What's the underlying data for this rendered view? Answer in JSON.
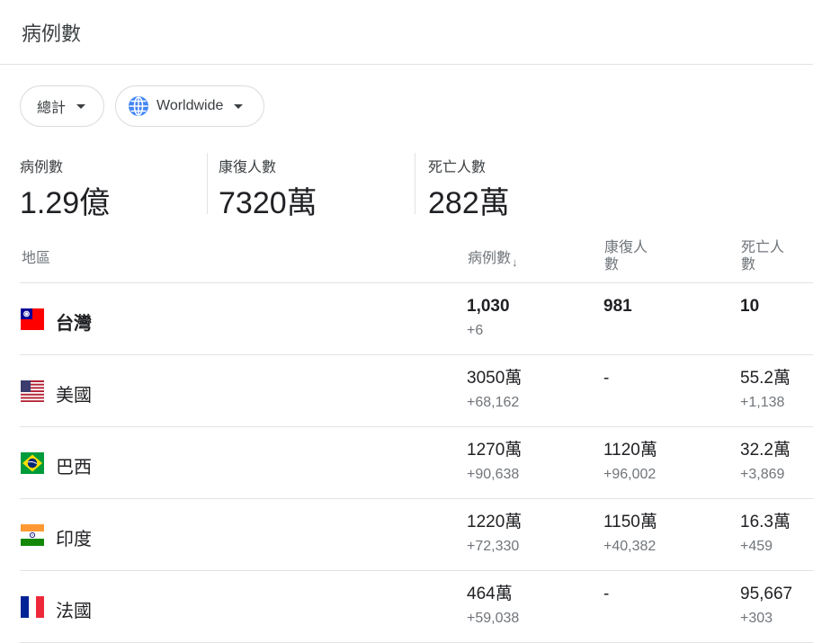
{
  "header": {
    "title": "病例數"
  },
  "filters": {
    "total_label": "總計",
    "region_label": "Worldwide"
  },
  "summary": [
    {
      "label": "病例數",
      "value": "1.29億"
    },
    {
      "label": "康復人數",
      "value": "7320萬"
    },
    {
      "label": "死亡人數",
      "value": "282萬"
    }
  ],
  "table": {
    "headers": {
      "region": "地區",
      "cases": "病例數",
      "sort_arrow": "↓",
      "recovered": "康復人數",
      "deaths": "死亡人數"
    },
    "rows": [
      {
        "country": "台灣",
        "flag": "taiwan-flag-icon",
        "cases": "1,030",
        "cases_delta": "+6",
        "recovered": "981",
        "recovered_delta": "",
        "deaths": "10",
        "deaths_delta": ""
      },
      {
        "country": "美國",
        "flag": "usa-flag-icon",
        "cases": "3050萬",
        "cases_delta": "+68,162",
        "recovered": "-",
        "recovered_delta": "",
        "deaths": "55.2萬",
        "deaths_delta": "+1,138"
      },
      {
        "country": "巴西",
        "flag": "brazil-flag-icon",
        "cases": "1270萬",
        "cases_delta": "+90,638",
        "recovered": "1120萬",
        "recovered_delta": "+96,002",
        "deaths": "32.2萬",
        "deaths_delta": "+3,869"
      },
      {
        "country": "印度",
        "flag": "india-flag-icon",
        "cases": "1220萬",
        "cases_delta": "+72,330",
        "recovered": "1150萬",
        "recovered_delta": "+40,382",
        "deaths": "16.3萬",
        "deaths_delta": "+459"
      },
      {
        "country": "法國",
        "flag": "france-flag-icon",
        "cases": "464萬",
        "cases_delta": "+59,038",
        "recovered": "-",
        "recovered_delta": "",
        "deaths": "95,667",
        "deaths_delta": "+303"
      }
    ]
  },
  "colors": {
    "text": "#202124",
    "secondary": "#70757a",
    "divider": "#e3e3e3",
    "globe": "#4285f4"
  }
}
